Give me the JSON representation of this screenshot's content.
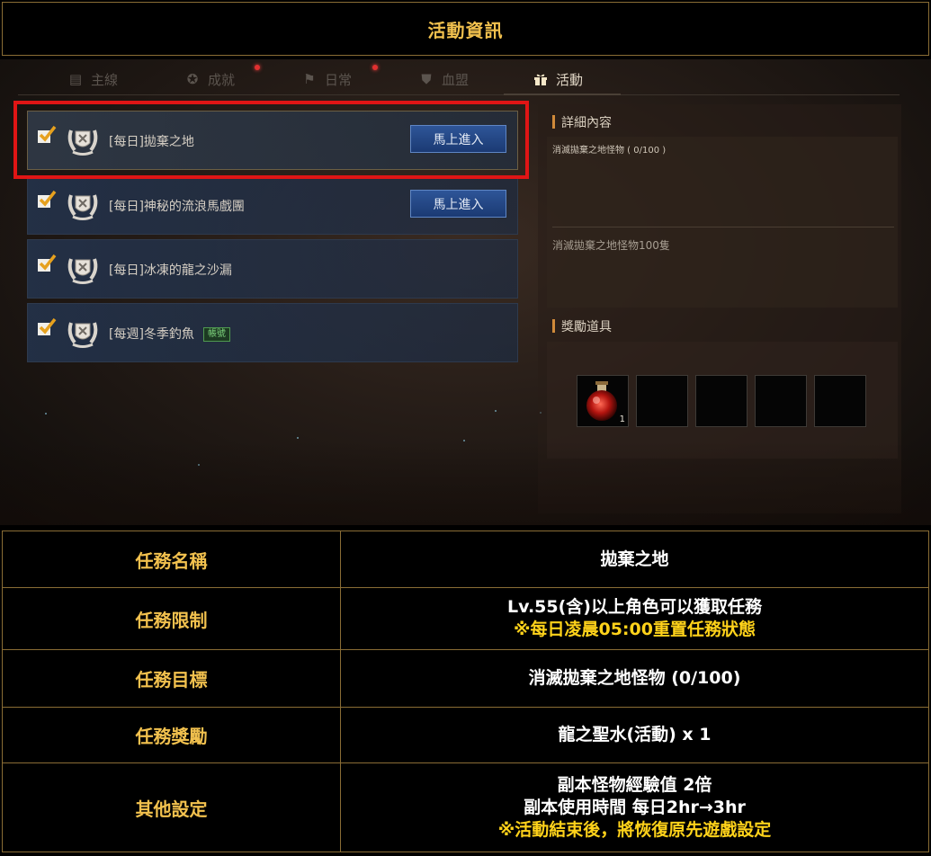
{
  "header": {
    "title": "活動資訊"
  },
  "tabs": [
    {
      "label": "主線",
      "icon": "book-icon"
    },
    {
      "label": "成就",
      "icon": "medal-icon"
    },
    {
      "label": "日常",
      "icon": "flag-icon"
    },
    {
      "label": "血盟",
      "icon": "shield-icon"
    },
    {
      "label": "活動",
      "icon": "gift-icon",
      "active": true
    }
  ],
  "tasks": [
    {
      "label": "[每日]拋棄之地",
      "button": "馬上進入",
      "selected": true
    },
    {
      "label": "[每日]神秘的流浪馬戲團",
      "button": "馬上進入"
    },
    {
      "label": "[每日]冰凍的龍之沙漏"
    },
    {
      "label": "[每週]冬季釣魚",
      "tag": "帳號"
    }
  ],
  "detail": {
    "section_title": "詳細內容",
    "objective": "消滅拋棄之地怪物 ( 0/100 )",
    "description": "消滅拋棄之地怪物100隻",
    "reward_title": "獎勵道具",
    "reward_qty": "1"
  },
  "table": {
    "rows": [
      {
        "label": "任務名稱",
        "lines": [
          "拋棄之地"
        ],
        "notes": []
      },
      {
        "label": "任務限制",
        "lines": [
          "Lv.55(含)以上角色可以獲取任務"
        ],
        "notes": [
          "※每日凌晨05:00重置任務狀態"
        ]
      },
      {
        "label": "任務目標",
        "lines": [
          "消滅拋棄之地怪物 (0/100)"
        ],
        "notes": []
      },
      {
        "label": "任務獎勵",
        "lines": [
          "龍之聖水(活動) x 1"
        ],
        "notes": []
      },
      {
        "label": "其他設定",
        "lines": [
          "副本怪物經驗值 2倍",
          "副本使用時間 每日2hr→3hr"
        ],
        "notes": [
          "※活動結束後，將恢復原先遊戲設定"
        ]
      }
    ]
  },
  "colors": {
    "gold": "#f2c14e",
    "note_yellow": "#ffd21a",
    "highlight_red": "#e01515",
    "button_blue": "#2e5598"
  }
}
